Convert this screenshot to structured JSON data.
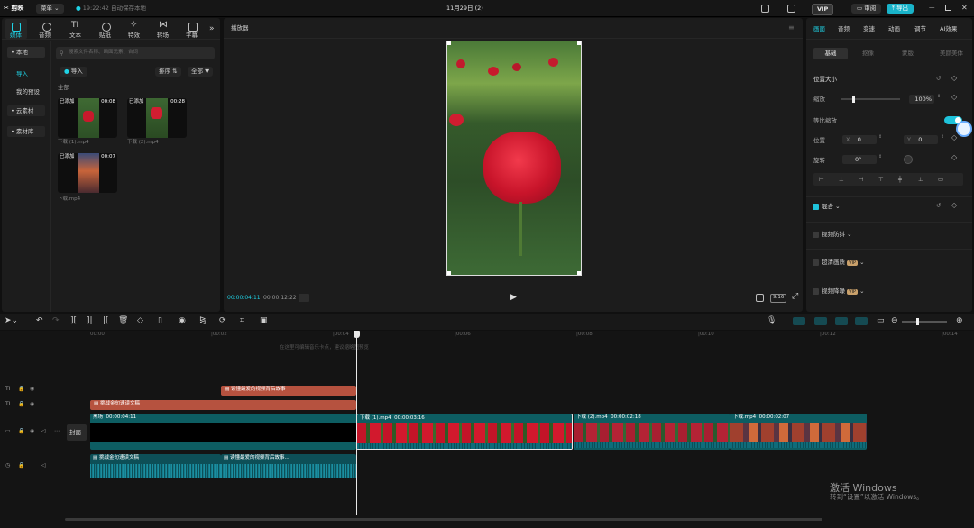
{
  "titlebar": {
    "app_name": "剪映",
    "menu_label": "菜单",
    "autosave": "19:22:42 自动保存本地",
    "project_title": "11月29日 (2)",
    "vip": "VIP",
    "review_label": "审阅",
    "export_label": "导出"
  },
  "media_tabs": [
    "媒体",
    "音频",
    "文本",
    "贴纸",
    "特效",
    "转场",
    "字幕"
  ],
  "media_sidebar": [
    "• 本地",
    "导入",
    "我的预设",
    "• 云素材",
    "• 素材库"
  ],
  "media": {
    "search_placeholder": "搜索文件名称、画面元素、台词",
    "import_label": "导入",
    "sort_label": "排序",
    "filter_label": "全部",
    "section_all": "全部",
    "items": [
      {
        "badge": "已添加",
        "duration": "00:08",
        "name": "下载 (1).mp4"
      },
      {
        "badge": "已添加",
        "duration": "00:28",
        "name": "下载 (2).mp4"
      },
      {
        "badge": "已添加",
        "duration": "00:07",
        "name": "下载.mp4"
      }
    ]
  },
  "player": {
    "title": "播放器",
    "current_time": "00:00:04:11",
    "total_time": "00:00:12:22",
    "ratio": "9:16"
  },
  "props": {
    "tabs": [
      "画面",
      "音频",
      "变速",
      "动画",
      "调节",
      "AI效果"
    ],
    "subtabs": [
      "基础",
      "抠像",
      "蒙版",
      "美颜美体"
    ],
    "section_size": "位置大小",
    "scale_label": "缩放",
    "scale_value": "100%",
    "uniform_label": "等比缩放",
    "position_label": "位置",
    "x_label": "X",
    "x_value": "0",
    "y_label": "Y",
    "y_value": "0",
    "rotate_label": "旋转",
    "rotate_value": "0°",
    "blend_label": "混合",
    "stabilize_label": "视频防抖",
    "hdr_label": "超清画质",
    "denoise_label": "视频降噪",
    "vip_badge": "VIP"
  },
  "timeline": {
    "hint": "在这里可编辑音乐卡点，建议缩略图预览",
    "ruler": [
      "00:00",
      "|00:02",
      "|00:04",
      "|00:06",
      "|00:08",
      "|00:10",
      "|00:12",
      "|00:14"
    ],
    "cover_label": "封面",
    "text_clip_1": "读懂最爱的视频背后故事",
    "text_clip_2": "挑战金句速读文稿",
    "main_clip": {
      "label": "黑场",
      "time": "00:00:04:11"
    },
    "clips": [
      {
        "name": "下载 (1).mp4",
        "time": "00:00:03:16"
      },
      {
        "name": "下载 (2).mp4",
        "time": "00:00:02:18"
      },
      {
        "name": "下载.mp4",
        "time": "00:00:02:07"
      }
    ],
    "audio_1": "挑战金句速读文稿",
    "audio_2": "读懂最爱的视频背后故事..."
  },
  "watermark": {
    "line1": "激活 Windows",
    "line2": "转到“设置”以激活 Windows。"
  },
  "colors": {
    "accent": "#1fd3e6",
    "text_clip": "#b6523f",
    "video_clip": "#0d5d62"
  }
}
